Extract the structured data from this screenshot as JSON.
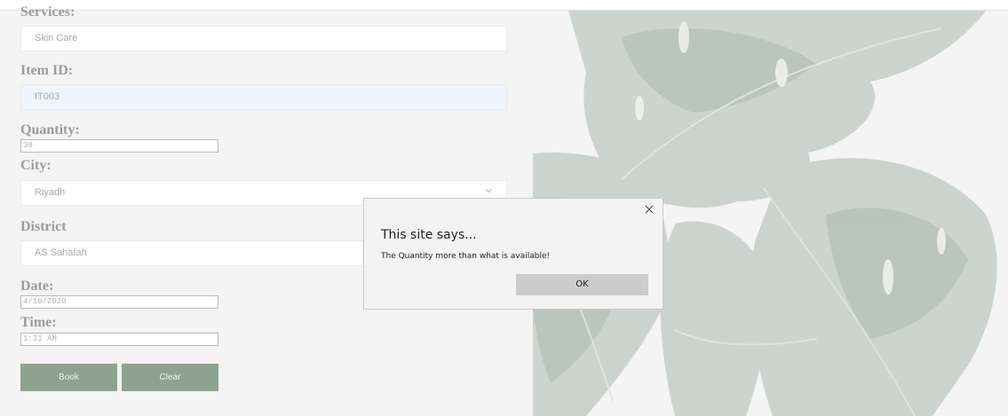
{
  "form": {
    "services": {
      "label": "Services:",
      "value": "Skin Care"
    },
    "item_id": {
      "label": "Item ID:",
      "value": "IT003"
    },
    "quantity": {
      "label": "Quantity:",
      "value": "30"
    },
    "city": {
      "label": "City:",
      "value": "Riyadh"
    },
    "district": {
      "label": "District",
      "value": "AS Sahafah"
    },
    "date": {
      "label": "Date:",
      "value": "4/10/2020"
    },
    "time": {
      "label": "Time:",
      "value": "1:31 AM"
    },
    "book_label": "Book",
    "clear_label": "Clear"
  },
  "dialog": {
    "title": "This site says...",
    "message": "The Quantity more than what is available!",
    "ok_label": "OK",
    "close_icon": "close-icon"
  },
  "colors": {
    "button_green": "#8da38f",
    "leaf_green": "#7f968a"
  }
}
